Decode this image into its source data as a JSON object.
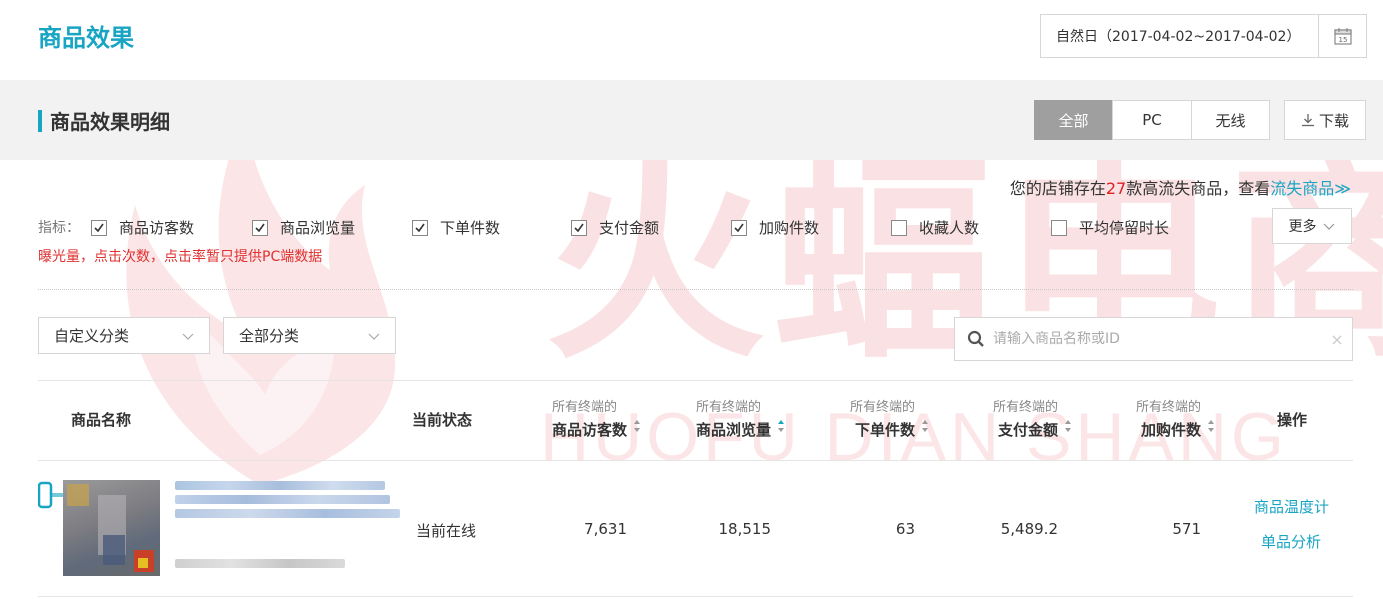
{
  "header": {
    "title": "商品效果",
    "date_range": "自然日（2017-04-02~2017-04-02）",
    "calendar_day": "15"
  },
  "section": {
    "title": "商品效果明细",
    "tabs": [
      {
        "label": "全部",
        "active": true
      },
      {
        "label": "PC",
        "active": false
      },
      {
        "label": "无线",
        "active": false
      }
    ],
    "download_label": "下载"
  },
  "notice": {
    "prefix": "您的店铺存在",
    "count": "27",
    "middle": "款高流失商品，查看",
    "link": "流失商品≫"
  },
  "indicators": {
    "label": "指标：",
    "items": [
      {
        "label": "商品访客数",
        "checked": true
      },
      {
        "label": "商品浏览量",
        "checked": true
      },
      {
        "label": "下单件数",
        "checked": true
      },
      {
        "label": "支付金额",
        "checked": true
      },
      {
        "label": "加购件数",
        "checked": true
      },
      {
        "label": "收藏人数",
        "checked": false
      },
      {
        "label": "平均停留时长",
        "checked": false
      }
    ],
    "more_label": "更多",
    "note": "曝光量，点击次数，点击率暂只提供PC端数据"
  },
  "filters": {
    "category1": "自定义分类",
    "category2": "全部分类",
    "search_placeholder": "请输入商品名称或ID",
    "clear": "×"
  },
  "table": {
    "headers": {
      "name": "商品名称",
      "status": "当前状态",
      "metric_prefix": "所有终端的",
      "metrics": [
        "商品访客数",
        "商品浏览量",
        "下单件数",
        "支付金额",
        "加购件数"
      ],
      "ops": "操作"
    },
    "rows": [
      {
        "status": "当前在线",
        "values": [
          "7,631",
          "18,515",
          "63",
          "5,489.2",
          "571"
        ],
        "ops": [
          "商品温度计",
          "单品分析"
        ]
      }
    ]
  },
  "colors": {
    "accent": "#18a5c4",
    "warning": "#e02020",
    "active_tab": "#9f9f9f"
  },
  "watermark": {
    "text": "火蝠电商",
    "sub": "HUOFU DIAN SHANG"
  }
}
